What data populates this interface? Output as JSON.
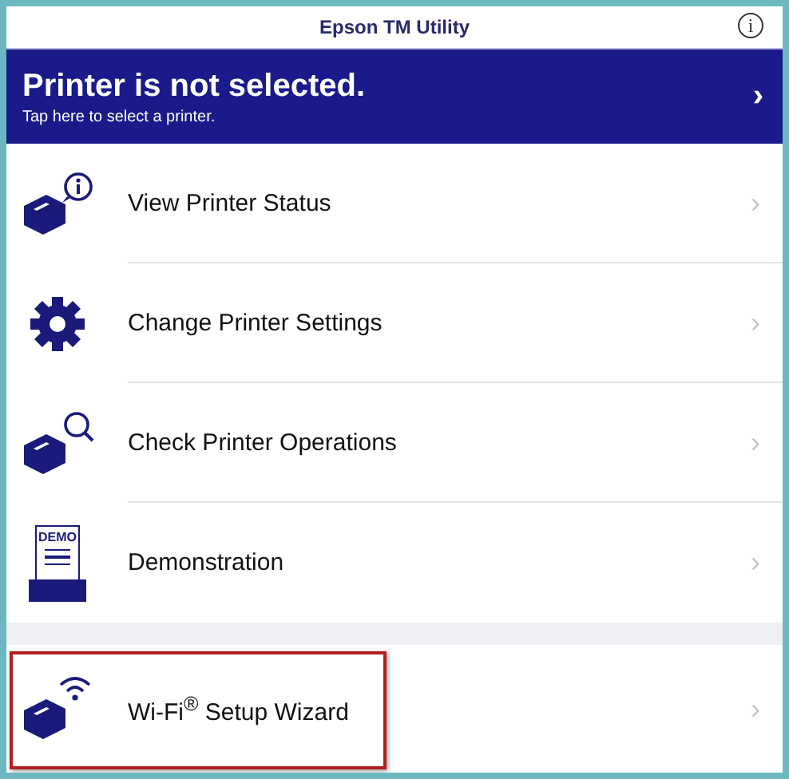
{
  "window": {
    "title": "Epson TM Utility",
    "info_button": "i"
  },
  "banner": {
    "title": "Printer is not selected.",
    "subtitle": "Tap here to select a printer.",
    "chevron": "›"
  },
  "sections": [
    {
      "items": [
        {
          "kind": "status",
          "label": "View Printer Status",
          "chevron": "›",
          "highlighted": false
        },
        {
          "kind": "settings",
          "label": "Change Printer Settings",
          "chevron": "›",
          "highlighted": false
        },
        {
          "kind": "operations",
          "label": "Check Printer Operations",
          "chevron": "›",
          "highlighted": false
        },
        {
          "kind": "demo",
          "label": "Demonstration",
          "icon_text": "DEMO",
          "chevron": "›",
          "highlighted": false
        }
      ]
    },
    {
      "items": [
        {
          "kind": "wifi",
          "label": "Wi-Fi$^{®}$ Setup Wizard",
          "chevron": "›",
          "highlighted": true
        }
      ]
    }
  ]
}
